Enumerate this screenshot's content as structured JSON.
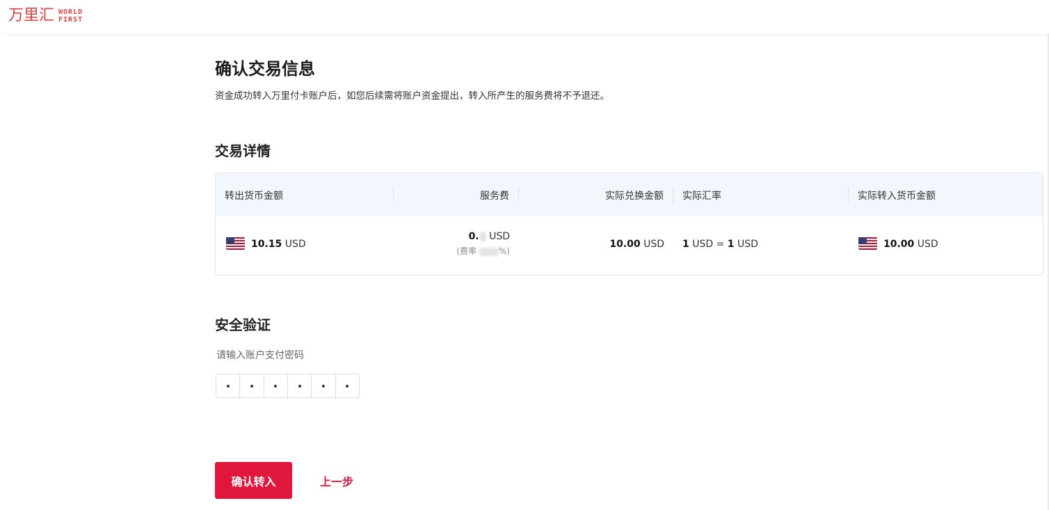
{
  "header": {
    "logo_cn": "万里汇",
    "logo_en_line1": "WORLD",
    "logo_en_line2": "FIRST",
    "brand_color": "#e0413f"
  },
  "page": {
    "title": "确认交易信息",
    "note": "资金成功转入万里付卡账户后，如您后续需将账户资金提出，转入所产生的服务费将不予退还。"
  },
  "details": {
    "section_title": "交易详情",
    "columns": [
      "转出货币金额",
      "服务费",
      "实际兑换金额",
      "实际汇率",
      "实际转入货币金额"
    ],
    "row": {
      "out_amount": "10.15",
      "out_currency": "USD",
      "fee_amount_visible": "0.",
      "fee_currency": "USD",
      "fee_rate_prefix": "(费率",
      "fee_rate_suffix": "%)",
      "exchange_amount": "10.00",
      "exchange_currency": "USD",
      "rate_from_value": "1",
      "rate_from_currency": "USD",
      "rate_eq": "=",
      "rate_to_value": "1",
      "rate_to_currency": "USD",
      "in_amount": "10.00",
      "in_currency": "USD",
      "flag_icon": "us-flag-icon"
    }
  },
  "security": {
    "section_title": "安全验证",
    "password_label": "请输入账户支付密码",
    "password_digits": 6
  },
  "actions": {
    "confirm_label": "确认转入",
    "back_label": "上一步",
    "primary_color": "#e1163c"
  }
}
